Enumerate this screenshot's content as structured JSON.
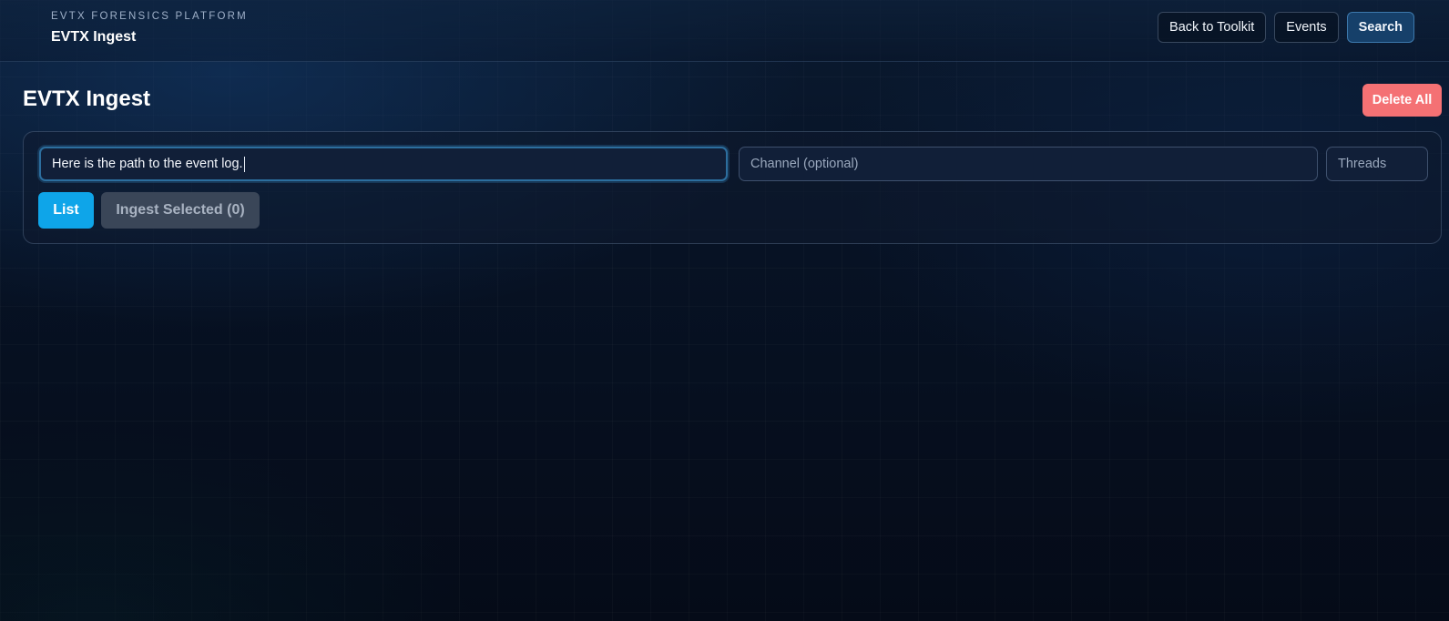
{
  "header": {
    "kicker": "EVTX FORENSICS PLATFORM",
    "title": "EVTX Ingest",
    "nav": {
      "back_label": "Back to Toolkit",
      "events_label": "Events",
      "search_label": "Search"
    }
  },
  "page": {
    "title": "EVTX Ingest",
    "delete_all_label": "Delete All"
  },
  "form": {
    "path_value": "Here is the path to the event log.",
    "channel_placeholder": "Channel (optional)",
    "channel_value": "",
    "threads_placeholder": "Threads",
    "threads_value": "",
    "list_label": "List",
    "ingest_label": "Ingest Selected (0)"
  },
  "colors": {
    "primary": "#0ea5e9",
    "danger": "#f47174",
    "active_nav": "#16406a",
    "disabled": "#3a4658"
  }
}
